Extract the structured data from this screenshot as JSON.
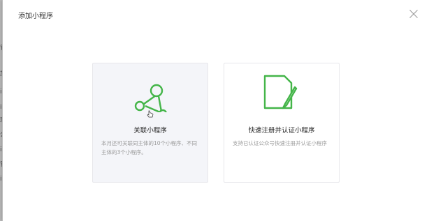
{
  "background": {
    "side_chars": [
      "管",
      "加",
      "i",
      "i",
      "理",
      "公",
      "i",
      "管",
      "i"
    ]
  },
  "dialog": {
    "title": "添加小程序",
    "close_icon": "close-icon"
  },
  "cards": [
    {
      "title": "关联小程序",
      "description": "本月还可关联同主体的10个小程序、不同主体的3个小程序。",
      "icon": "link-graph-icon",
      "highlighted": true
    },
    {
      "title": "快速注册并认证小程序",
      "description": "支持已认证公众号快速注册并认证小程序",
      "icon": "document-pen-icon",
      "highlighted": false
    }
  ],
  "colors": {
    "accent_green": "#44b549",
    "card_highlight_bg": "#f4f5f9"
  }
}
